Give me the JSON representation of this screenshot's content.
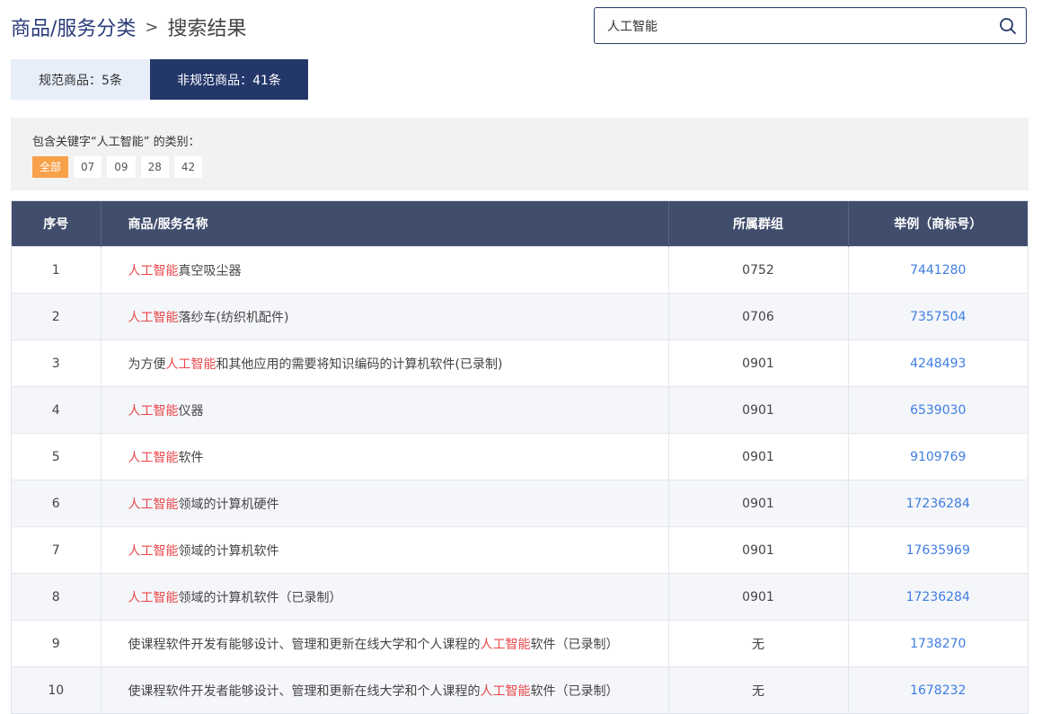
{
  "breadcrumb": {
    "link": "商品/服务分类",
    "separator": ">",
    "current": "搜索结果"
  },
  "search": {
    "value": "人工智能",
    "placeholder": "",
    "icon": "search-icon"
  },
  "tabs": [
    {
      "label": "规范商品：5条",
      "active": false
    },
    {
      "label": "非规范商品：41条",
      "active": true
    }
  ],
  "filter": {
    "label": "包含关键字“人工智能” 的类别：",
    "chips": [
      {
        "label": "全部",
        "active": true
      },
      {
        "label": "07",
        "active": false
      },
      {
        "label": "09",
        "active": false
      },
      {
        "label": "28",
        "active": false
      },
      {
        "label": "42",
        "active": false
      }
    ]
  },
  "keyword": "人工智能",
  "table": {
    "headers": [
      "序号",
      "商品/服务名称",
      "所属群组",
      "举例（商标号）"
    ],
    "rows": [
      {
        "no": "1",
        "name": [
          "",
          "人工智能",
          "真空吸尘器"
        ],
        "group": "0752",
        "example": "7441280"
      },
      {
        "no": "2",
        "name": [
          "",
          "人工智能",
          "落纱车(纺织机配件)"
        ],
        "group": "0706",
        "example": "7357504"
      },
      {
        "no": "3",
        "name": [
          "为方便",
          "人工智能",
          "和其他应用的需要将知识编码的计算机软件(已录制)"
        ],
        "group": "0901",
        "example": "4248493"
      },
      {
        "no": "4",
        "name": [
          "",
          "人工智能",
          "仪器"
        ],
        "group": "0901",
        "example": "6539030"
      },
      {
        "no": "5",
        "name": [
          "",
          "人工智能",
          "软件"
        ],
        "group": "0901",
        "example": "9109769"
      },
      {
        "no": "6",
        "name": [
          "",
          "人工智能",
          "领域的计算机硬件"
        ],
        "group": "0901",
        "example": "17236284"
      },
      {
        "no": "7",
        "name": [
          "",
          "人工智能",
          "领域的计算机软件"
        ],
        "group": "0901",
        "example": "17635969"
      },
      {
        "no": "8",
        "name": [
          "",
          "人工智能",
          "领域的计算机软件（已录制）"
        ],
        "group": "0901",
        "example": "17236284"
      },
      {
        "no": "9",
        "name": [
          "使课程软件开发有能够设计、管理和更新在线大学和个人课程的",
          "人工智能",
          "软件（已录制）"
        ],
        "group": "无",
        "example": "1738270"
      },
      {
        "no": "10",
        "name": [
          "使课程软件开发者能够设计、管理和更新在线大学和个人课程的",
          "人工智能",
          "软件（已录制）"
        ],
        "group": "无",
        "example": "1678232"
      }
    ]
  },
  "colors": {
    "primary": "#233769",
    "header_bg": "#414d6c",
    "highlight": "#e8484b",
    "link": "#3f7de0",
    "chip_active": "#f7a14a"
  }
}
